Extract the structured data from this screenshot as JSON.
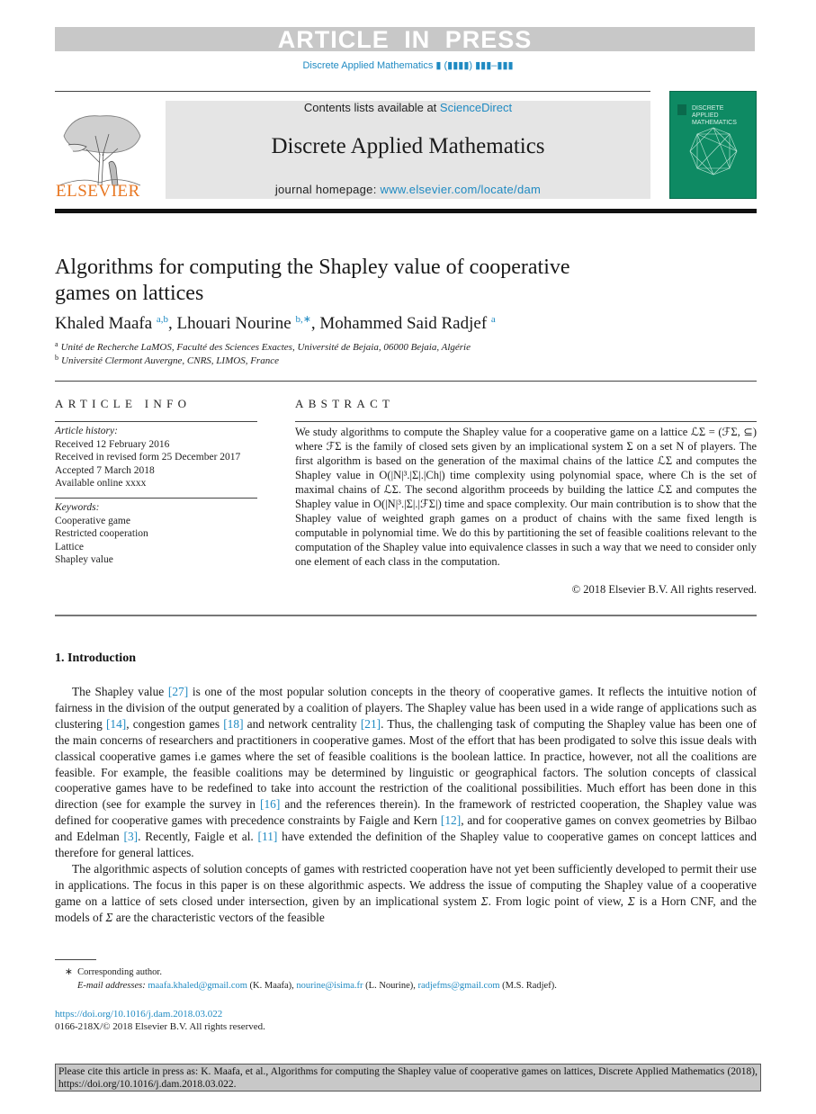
{
  "header": {
    "press_banner": "ARTICLE IN PRESS",
    "journal_ref": "Discrete Applied Mathematics ▮ (▮▮▮▮) ▮▮▮–▮▮▮",
    "contents_prefix": "Contents lists available at ",
    "contents_link": "ScienceDirect",
    "journal_name": "Discrete Applied Mathematics",
    "homepage_prefix": "journal homepage: ",
    "homepage_link": "www.elsevier.com/locate/dam",
    "publisher_logo_text": "ELSEVIER",
    "cover_title_lines": [
      "DISCRETE",
      "APPLIED",
      "MATHEMATICS"
    ],
    "colors": {
      "link": "#1f8ac2",
      "publisher_orange": "#e87722",
      "cover_green": "#0e8a63",
      "banner_gray": "#c8c8c8",
      "journal_box": "#e5e5e5"
    }
  },
  "article": {
    "title_line1": "Algorithms for computing the Shapley value of cooperative",
    "title_line2": "games on lattices",
    "authors": [
      {
        "name": "Khaled Maafa",
        "sup": "a,b",
        "sep": ", "
      },
      {
        "name": "Lhouari Nourine",
        "sup": "b,∗",
        "sep": ", "
      },
      {
        "name": "Mohammed Said Radjef",
        "sup": "a",
        "sep": ""
      }
    ],
    "affiliations": [
      {
        "label": "a",
        "text": "Unité de Recherche LaMOS, Faculté des Sciences Exactes, Université de Bejaia, 06000 Bejaia, Algérie"
      },
      {
        "label": "b",
        "text": "Université Clermont Auvergne, CNRS, LIMOS, France"
      }
    ]
  },
  "article_info": {
    "heading": "ARTICLE INFO",
    "history_label": "Article history:",
    "history": [
      "Received 12 February 2016",
      "Received in revised form 25 December 2017",
      "Accepted 7 March 2018",
      "Available online xxxx"
    ],
    "keywords_label": "Keywords:",
    "keywords": [
      "Cooperative game",
      "Restricted cooperation",
      "Lattice",
      "Shapley value"
    ]
  },
  "abstract": {
    "heading": "ABSTRACT",
    "text": "We study algorithms to compute the Shapley value for a cooperative game on a lattice ℒΣ = (ℱΣ, ⊆) where ℱΣ is the family of closed sets given by an implicational system Σ on a set N of players. The first algorithm is based on the generation of the maximal chains of the lattice ℒΣ and computes the Shapley value in O(|N|³.|Σ|.|Ch|) time complexity using polynomial space, where Ch is the set of maximal chains of ℒΣ. The second algorithm proceeds by building the lattice ℒΣ and computes the Shapley value in O(|N|³.|Σ|.|ℱΣ|) time and space complexity. Our main contribution is to show that the Shapley value of weighted graph games on a product of chains with the same fixed length is computable in polynomial time. We do this by partitioning the set of feasible coalitions relevant to the computation of the Shapley value into equivalence classes in such a way that we need to consider only one element of each class in the computation.",
    "copyright": "© 2018 Elsevier B.V. All rights reserved."
  },
  "body": {
    "section_heading": "1.  Introduction",
    "paragraphs": [
      [
        {
          "t": "The Shapley value "
        },
        {
          "r": "[27]"
        },
        {
          "t": " is one of the most popular solution concepts in the theory of cooperative games. It reflects the intuitive notion of fairness in the division of the output generated by a coalition of players. The Shapley value has been used in a wide range of applications such as clustering "
        },
        {
          "r": "[14]"
        },
        {
          "t": ", congestion games "
        },
        {
          "r": "[18]"
        },
        {
          "t": " and network centrality "
        },
        {
          "r": "[21]"
        },
        {
          "t": ". Thus, the challenging task of computing the Shapley value has been one of the main concerns of researchers and practitioners in cooperative games. Most of the effort that has been prodigated to solve this issue deals with classical cooperative games i.e games where the set of feasible coalitions is the boolean lattice. In practice, however, not all the coalitions are feasible. For example, the feasible coalitions may be determined by linguistic or geographical factors. The solution concepts of classical cooperative games have to be redefined to take into account the restriction of the coalitional possibilities. Much effort has been done in this direction (see for example the survey in "
        },
        {
          "r": "[16]"
        },
        {
          "t": " and the references therein). In the framework of restricted cooperation, the Shapley value was defined for cooperative games with precedence constraints by Faigle and Kern "
        },
        {
          "r": "[12]"
        },
        {
          "t": ", and for cooperative games on convex geometries by Bilbao and Edelman "
        },
        {
          "r": "[3]"
        },
        {
          "t": ". Recently, Faigle et al. "
        },
        {
          "r": "[11]"
        },
        {
          "t": " have extended the definition of the Shapley value to cooperative games on concept lattices and therefore for general lattices."
        }
      ],
      [
        {
          "t": "The algorithmic aspects of solution concepts of games with restricted cooperation have not yet been sufficiently developed to permit their use in applications. The focus in this paper is on these algorithmic aspects. We address the issue of computing the Shapley value of a cooperative game on a lattice of sets closed under intersection, given by an implicational system "
        },
        {
          "m": "Σ"
        },
        {
          "t": ". From logic point of view, "
        },
        {
          "m": "Σ"
        },
        {
          "t": " is a Horn CNF, and the models of "
        },
        {
          "m": "Σ"
        },
        {
          "t": " are the characteristic vectors of the feasible"
        }
      ]
    ]
  },
  "footnotes": {
    "corresponding_mark": "∗",
    "corresponding_text": "Corresponding author.",
    "email_label": "E-mail addresses:",
    "emails": [
      {
        "address": "maafa.khaled@gmail.com",
        "owner": " (K. Maafa), "
      },
      {
        "address": "nourine@isima.fr",
        "owner": " (L. Nourine), "
      },
      {
        "address": "radjefms@gmail.com",
        "owner": " (M.S. Radjef)."
      }
    ],
    "doi": "https://doi.org/10.1016/j.dam.2018.03.022",
    "issn": "0166-218X/© 2018 Elsevier B.V. All rights reserved."
  },
  "citation_box": "Please cite this article in press as: K. Maafa, et al., Algorithms for computing the Shapley value of cooperative games on lattices, Discrete Applied Mathematics (2018), https://doi.org/10.1016/j.dam.2018.03.022."
}
